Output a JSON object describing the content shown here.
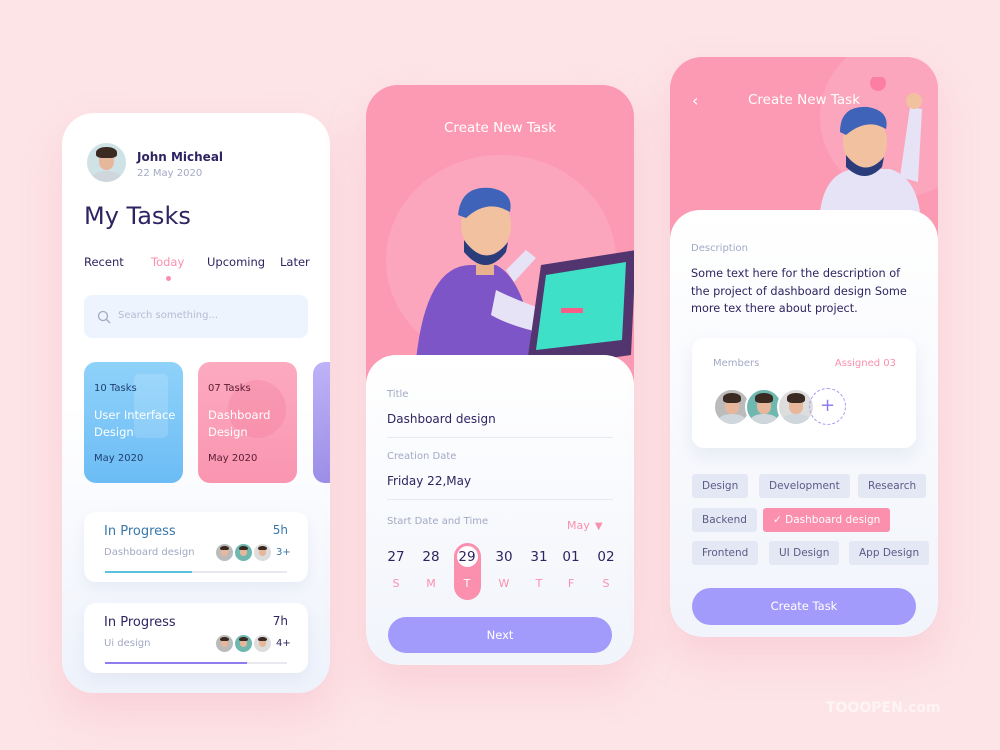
{
  "screen1": {
    "user": {
      "name": "John Micheal",
      "date": "22 May 2020"
    },
    "title": "My Tasks",
    "tabs": [
      {
        "label": "Recent",
        "active": false
      },
      {
        "label": "Today",
        "active": true
      },
      {
        "label": "Upcoming",
        "active": false
      },
      {
        "label": "Later",
        "active": false
      }
    ],
    "search_placeholder": "Search something...",
    "categories": [
      {
        "count": "10 Tasks",
        "name_line1": "User Interface",
        "name_line2": "Design",
        "date": "May 2020",
        "color": "#7ec9f7"
      },
      {
        "count": "07 Tasks",
        "name_line1": "Dashboard",
        "name_line2": "Design",
        "date": "May 2020",
        "color": "#fb9fb7"
      }
    ],
    "progress": [
      {
        "status": "In Progress",
        "project": "Dashboard design",
        "hours": "5h",
        "extra": "3+",
        "progress": 0.48,
        "color": "#5bc0de"
      },
      {
        "status": "In Progress",
        "project": "Ui design",
        "hours": "7h",
        "extra": "4+",
        "progress": 0.78,
        "color": "#8f7df0"
      }
    ]
  },
  "screen2": {
    "header": "Create New Task",
    "title_label": "Title",
    "title_value": "Dashboard design",
    "creation_label": "Creation Date",
    "creation_value": "Friday 22,May",
    "start_label": "Start Date and Time",
    "month": "May",
    "days": [
      {
        "num": "27",
        "dow": "S"
      },
      {
        "num": "28",
        "dow": "M"
      },
      {
        "num": "29",
        "dow": "T",
        "selected": true
      },
      {
        "num": "30",
        "dow": "W"
      },
      {
        "num": "31",
        "dow": "T"
      },
      {
        "num": "01",
        "dow": "F"
      },
      {
        "num": "02",
        "dow": "S"
      }
    ],
    "next_label": "Next"
  },
  "screen3": {
    "header": "Create New Task",
    "description_label": "Description",
    "description": "Some text here for the description of the project of dashboard design Some more tex there about project.",
    "members_label": "Members",
    "assigned": "Assigned 03",
    "tags": [
      {
        "label": "Design"
      },
      {
        "label": "Development"
      },
      {
        "label": "Research"
      },
      {
        "label": "Backend"
      },
      {
        "label": "Dashboard design",
        "selected": true
      },
      {
        "label": "Frontend"
      },
      {
        "label": "UI Design"
      },
      {
        "label": "App Design"
      }
    ],
    "create_label": "Create Task"
  },
  "colors": {
    "pink": "#fb8fae",
    "purple": "#a39bfb",
    "navy": "#2e2461",
    "background": "#fde4e7"
  },
  "watermark": "TOOOPEN.com"
}
